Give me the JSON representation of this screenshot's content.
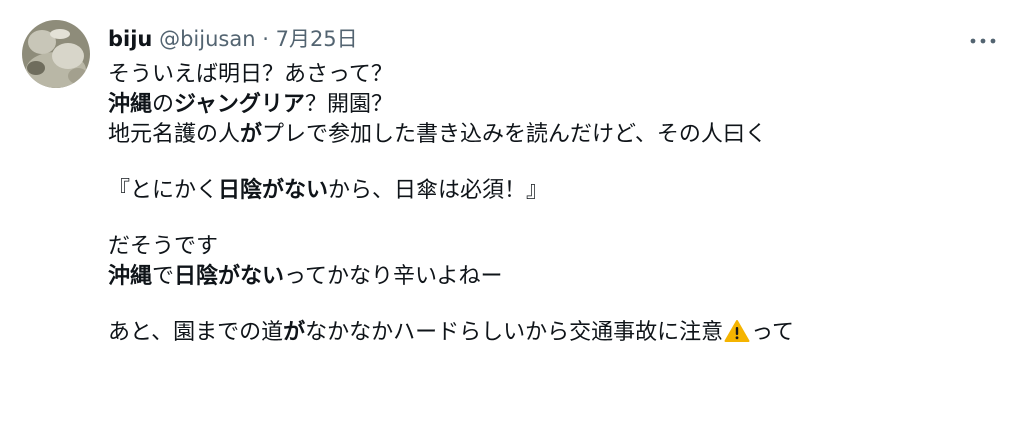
{
  "author": {
    "name": "biju",
    "handle": "@bijusan",
    "separator": "·",
    "date": "7月25日"
  },
  "tweet": {
    "line1": "そういえば明日？あさって？",
    "line2": {
      "a": "沖縄",
      "b": "の",
      "c": "ジャングリア",
      "d": "？開園？"
    },
    "line3": {
      "a": "地元名護の人",
      "b": "が",
      "c": "プレで参加した書き込みを読んだけど、その人曰く"
    },
    "line4": {
      "a": "『とにかく",
      "b": "日陰がない",
      "c": "から、日傘は必須！』"
    },
    "line5": "だそうです",
    "line6": {
      "a": "沖縄",
      "b": "で",
      "c": "日陰がない",
      "d": "ってかなり辛いよねー"
    },
    "line7": {
      "a": "あと、園までの道",
      "b": "が",
      "c": "なかなかハードらしいから交通事故に注意",
      "d": "って"
    }
  },
  "icons": {
    "more": "more-horizontal-icon",
    "warning": "warning-icon"
  },
  "colors": {
    "text": "#0f1419",
    "secondary": "#536471",
    "warning": "#f5b400"
  }
}
